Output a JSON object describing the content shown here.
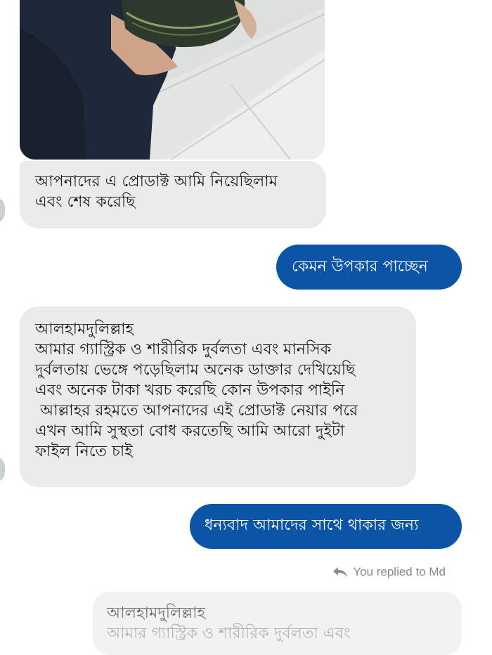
{
  "messages": {
    "first_incoming": "আপনাদের এ প্রোডাক্ট আমি নিয়েছিলাম\nএবং শেষ করেছি",
    "first_outgoing": "কেমন উপকার পাচ্ছেন",
    "second_incoming": "আলহামদুলিল্লাহ\nআমার গ্যাস্ট্রিক ও শারীরিক দুর্বলতা এবং মানসিক\nদুর্বলতায় ভেঙ্গে পড়েছিলাম অনেক ডাক্তার দেখিয়েছি\nএবং অনেক টাকা খরচ করেছি কোন উপকার পাইনি\n আল্লাহর রহমতে আপনাদের এই প্রোডাক্ট নেয়ার পরে\nএখন আমি সুস্থতা বোধ করতেছি আমি আরো দুইটা\nফাইল নিতে চাই",
    "second_outgoing": "ধন্যবাদ আমাদের সাথে থাকার জন্য"
  },
  "reply_indicator": {
    "text": "You replied to Md",
    "icon": "reply-arrow-icon"
  },
  "quoted_message": {
    "first_line": "আলহামদুলিল্লাহ",
    "second_line": "আমার গ্যাস্ট্রিক ও শারীরিক দুর্বলতা এবং"
  },
  "colors": {
    "outgoing_bubble": "#0b54a6",
    "incoming_bubble": "#ebebeb",
    "meta_text": "#8b8b8b"
  }
}
